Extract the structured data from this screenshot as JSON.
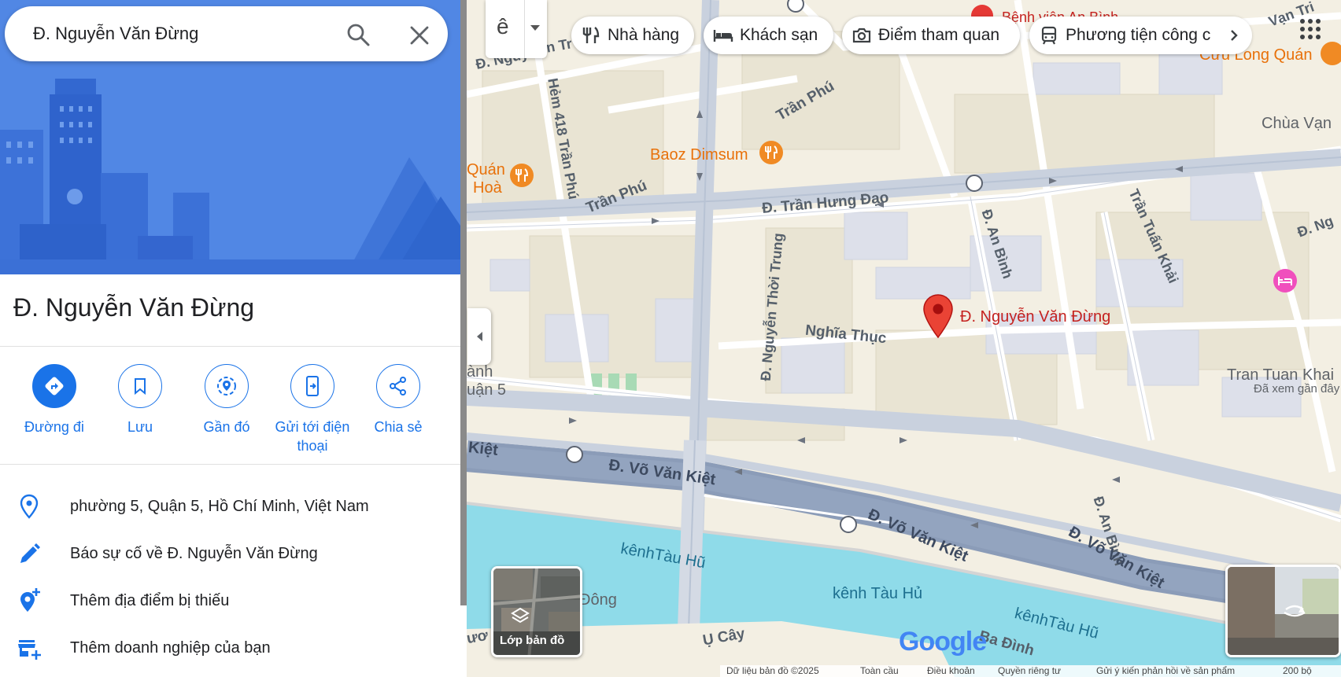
{
  "search": {
    "value": "Đ. Nguyễn Văn Đừng"
  },
  "place": {
    "title": "Đ. Nguyễn Văn Đừng"
  },
  "actions": [
    {
      "label": "Đường đi",
      "icon": "directions-icon"
    },
    {
      "label": "Lưu",
      "icon": "bookmark-icon"
    },
    {
      "label": "Gần đó",
      "icon": "nearby-icon"
    },
    {
      "label": "Gửi tới điện thoại",
      "icon": "send-to-phone-icon"
    },
    {
      "label": "Chia sẻ",
      "icon": "share-icon"
    }
  ],
  "info": [
    {
      "text": "phường 5, Quận 5, Hồ Chí Minh, Việt Nam",
      "icon": "location-pin-icon"
    },
    {
      "text": "Báo sự cố về Đ. Nguyễn Văn Đừng",
      "icon": "pencil-icon"
    },
    {
      "text": "Thêm địa điểm bị thiếu",
      "icon": "add-place-icon"
    },
    {
      "text": "Thêm doanh nghiệp của bạn",
      "icon": "add-business-icon"
    }
  ],
  "map": {
    "language_glyph": "ê",
    "chips": [
      {
        "label": "Nhà hàng",
        "icon": "restaurant-icon"
      },
      {
        "label": "Khách sạn",
        "icon": "hotel-icon"
      },
      {
        "label": "Điểm tham quan",
        "icon": "camera-icon"
      },
      {
        "label": "Phương tiện công c",
        "icon": "transit-icon"
      }
    ],
    "labels": {
      "pin": "Đ. Nguyễn Văn Đừng",
      "tran_phu_1": "Trần Phú",
      "tran_phu_2": "Trần Phú",
      "hem_418": "Hẻm 418 Trần Phú",
      "nguyen_top": "Đ. Nguy",
      "nguyen_top2": "n Tr",
      "tran_hung_dao": "Đ. Trần Hưng Đạo",
      "nguyen_thoi_trung": "Đ. Nguyễn Thời Trung",
      "nghia_thuc": "Nghĩa Thục",
      "an_binh_1": "Đ. An Bình",
      "an_binh_2": "Đ. An Bình",
      "tran_tuan_khai": "Trần Tuấn Khải",
      "d_ng": "Đ. Ng",
      "vo_van_kiet_1": "Đ. Võ Văn Kiệt",
      "vo_van_kiet_2": "Đ. Võ Văn Kiệt",
      "vo_van_kiet_3": "Đ. Võ Văn Kiệt",
      "kiet_left": "Kiệt",
      "kenh_tau_hu_1": "kênhTàu Hũ",
      "kenh_tau_hu_2": "kênh Tàu Hủ",
      "kenh_tau_hu_3": "kênhTàu Hũ",
      "baoz_dimsum": "Baoz Dimsum",
      "quan_hoa_1": "Quán",
      "quan_hoa_2": "Hoà",
      "cuu_long_quan": "Cửu Long Quán",
      "benh_vien": "Bệnh viện An Bình",
      "chua_van": "Chùa Vạn",
      "van_tri": "Vạn Tri",
      "tran_tuan_khai_place": "Tran Tuan Khai",
      "da_xem_gan_day": "Đã xem gần đây",
      "nh_left": "ành",
      "quan5_left": "uận 5",
      "dong": "Đông",
      "u_cay": "Ụ Cây",
      "ba_dinh": "Ba Đình",
      "uo_left": "ươ"
    },
    "layers_label": "Lớp bản đồ",
    "google_logo": "Google",
    "footer": {
      "data": "Dữ liệu bản đồ ©2025",
      "global": "Toàn cầu",
      "terms": "Điều khoản",
      "privacy": "Quyền riêng tư",
      "feedback": "Gửi ý kiến phản hồi về sản phẩm",
      "scale": "200 bộ"
    }
  }
}
